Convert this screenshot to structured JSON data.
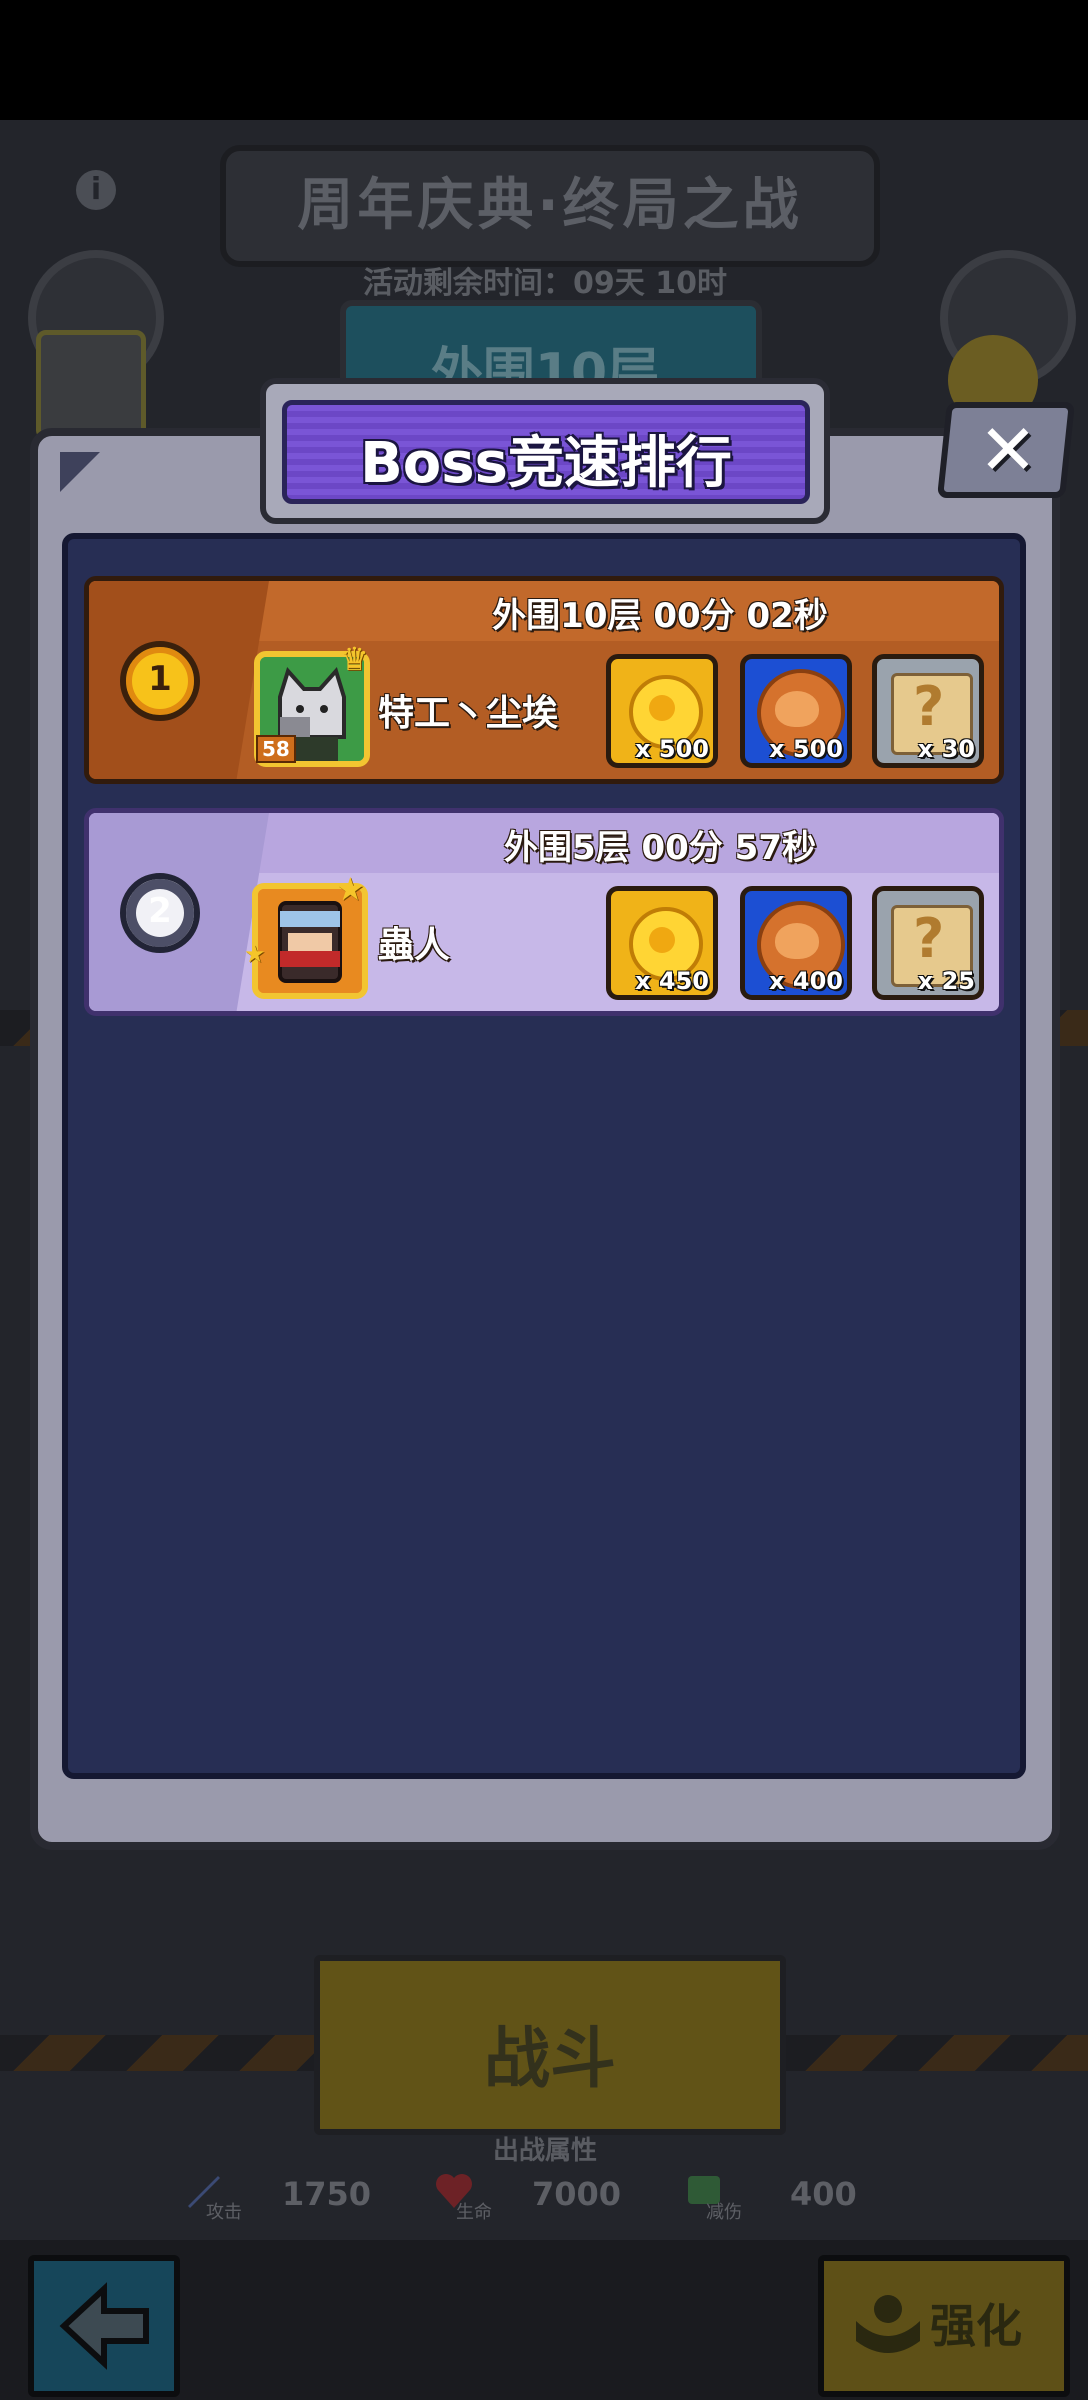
{
  "background": {
    "event_title": "周年庆典·终局之战",
    "remaining_time": "活动剩余时间：09天 10时",
    "floor_tab": "外围10层",
    "avatar_level": "58",
    "fight_button": "战斗",
    "attributes_title": "出战属性",
    "stats": [
      {
        "label": "攻击",
        "value": "1750"
      },
      {
        "label": "生命",
        "value": "7000"
      },
      {
        "label": "减伤",
        "value": "400"
      }
    ],
    "upgrade_button": "强化"
  },
  "modal": {
    "title": "Boss竞速排行",
    "close_symbol": "✕",
    "entries": [
      {
        "rank": "1",
        "record": "外围10层 00分 02秒",
        "player_name": "特工丶尘埃",
        "avatar_level": "58",
        "avatar_icon": "cat-avatar",
        "rewards": [
          {
            "icon": "gold-coin-icon",
            "count": "x 500"
          },
          {
            "icon": "dog-cookie-icon",
            "count": "x 500"
          },
          {
            "icon": "mystery-scroll-icon",
            "count": "x 30"
          }
        ]
      },
      {
        "rank": "2",
        "record": "外围5层 00分 57秒",
        "player_name": "蟲人",
        "avatar_icon": "ninja-avatar",
        "rewards": [
          {
            "icon": "gold-coin-icon",
            "count": "x 450"
          },
          {
            "icon": "dog-cookie-icon",
            "count": "x 400"
          },
          {
            "icon": "mystery-scroll-icon",
            "count": "x 25"
          }
        ]
      }
    ]
  },
  "colors": {
    "first_place_row": "#b35d24",
    "second_place_row": "#c7b8e8",
    "title_bar": "#7a55d6",
    "list_bg": "#272e54",
    "modal_frame": "#9a9aac"
  }
}
